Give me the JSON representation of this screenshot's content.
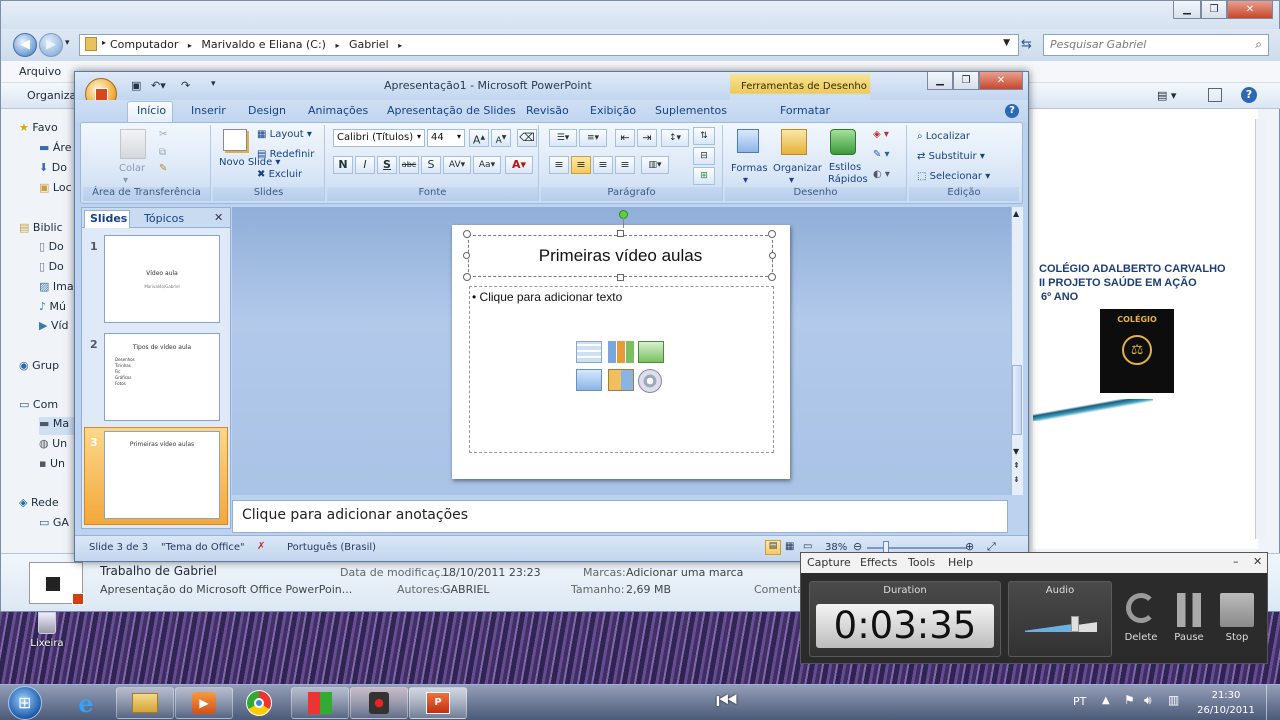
{
  "explorer": {
    "breadcrumb": [
      "Computador",
      "Marivaldo e Eliana (C:)",
      "Gabriel"
    ],
    "search_placeholder": "Pesquisar Gabriel",
    "menu": [
      "Arquivo"
    ],
    "toolbar_left": "Organiza",
    "nav_items": [
      {
        "label": "Favo",
        "icon": "star-icon"
      },
      {
        "label": "Áre",
        "icon": "desktop-icon"
      },
      {
        "label": "Do",
        "icon": "downloads-icon"
      },
      {
        "label": "Loc",
        "icon": "recent-places-icon"
      },
      {
        "label": "Biblic",
        "icon": "libraries-icon"
      },
      {
        "label": "Do",
        "icon": "documents-icon"
      },
      {
        "label": "Do",
        "icon": "documents-icon"
      },
      {
        "label": "Ima",
        "icon": "pictures-icon"
      },
      {
        "label": "Mú",
        "icon": "music-icon"
      },
      {
        "label": "Víd",
        "icon": "videos-icon"
      },
      {
        "label": "Grup",
        "icon": "homegroup-icon"
      },
      {
        "label": "Com",
        "icon": "computer-icon"
      },
      {
        "label": "Ma",
        "icon": "drive-icon"
      },
      {
        "label": "Un",
        "icon": "drive-icon"
      },
      {
        "label": "Un",
        "icon": "drive-icon"
      },
      {
        "label": "Rede",
        "icon": "network-icon"
      },
      {
        "label": "GA",
        "icon": "network-pc-icon"
      }
    ],
    "preview_lines": [
      "COLÉGIO ADALBERTO CARVALHO",
      "II PROJETO SAÚDE EM AÇÃO",
      "6º ANO"
    ],
    "preview_logo_top": "COLÉGIO",
    "details": {
      "file_name": "Trabalho de Gabriel",
      "file_type": "Apresentação do Microsoft Office PowerPoin...",
      "modified_label": "Data de modificaç...",
      "modified_value": "18/10/2011 23:23",
      "authors_label": "Autores:",
      "authors_value": "GABRIEL",
      "tags_label": "Marcas:",
      "tags_value": "Adicionar uma marca",
      "size_label": "Tamanho:",
      "size_value": "2,69 MB",
      "comments_label": "Comenta"
    },
    "recycle_bin": "Lixeira"
  },
  "ppt": {
    "title": "Apresentação1 - Microsoft PowerPoint",
    "context_tab_group": "Ferramentas de Desenho",
    "tabs": [
      "Início",
      "Inserir",
      "Design",
      "Animações",
      "Apresentação de Slides",
      "Revisão",
      "Exibição",
      "Suplementos",
      "Formatar"
    ],
    "ribbon": {
      "clipboard": {
        "paste": "Colar",
        "label": "Área de Transferência"
      },
      "slides": {
        "new_slide": "Novo Slide",
        "layout": "Layout",
        "reset": "Redefinir",
        "delete": "Excluir",
        "label": "Slides"
      },
      "font": {
        "font_name": "Calibri (Títulos)",
        "font_size": "44",
        "label": "Fonte"
      },
      "paragraph": {
        "label": "Parágrafo"
      },
      "drawing": {
        "shapes": "Formas",
        "arrange": "Organizar",
        "quick_styles": "Estilos Rápidos",
        "label": "Desenho"
      },
      "editing": {
        "find": "Localizar",
        "replace": "Substituir",
        "select": "Selecionar",
        "label": "Edição"
      }
    },
    "pane_tabs": [
      "Slides",
      "Tópicos"
    ],
    "thumbnails": [
      {
        "num": "1",
        "title": "Vídeo aula",
        "sub": "Marivaldo/Gabriel"
      },
      {
        "num": "2",
        "title": "Tipos de vídeo aula",
        "bullets": [
          "Desenhos",
          "Tirinhas",
          "Fic",
          "Gráficos",
          "Fotos"
        ]
      },
      {
        "num": "3",
        "title": "Primeiras vídeo aulas"
      }
    ],
    "slide": {
      "title": "Primeiras vídeo aulas",
      "bullet": "Clique para adicionar texto"
    },
    "notes_placeholder": "Clique para adicionar anotações",
    "status": {
      "slide_of": "Slide 3 de 3",
      "theme": "\"Tema do Office\"",
      "language": "Português (Brasil)",
      "zoom": "38%"
    }
  },
  "capture": {
    "menu": [
      "Capture",
      "Effects",
      "Tools",
      "Help"
    ],
    "duration_label": "Duration",
    "duration_value": "0:03:35",
    "audio_label": "Audio",
    "audio_level": 0.7,
    "buttons": [
      "Delete",
      "Pause",
      "Stop"
    ]
  },
  "taskbar": {
    "language": "PT",
    "time": "21:30",
    "date": "26/10/2011"
  }
}
